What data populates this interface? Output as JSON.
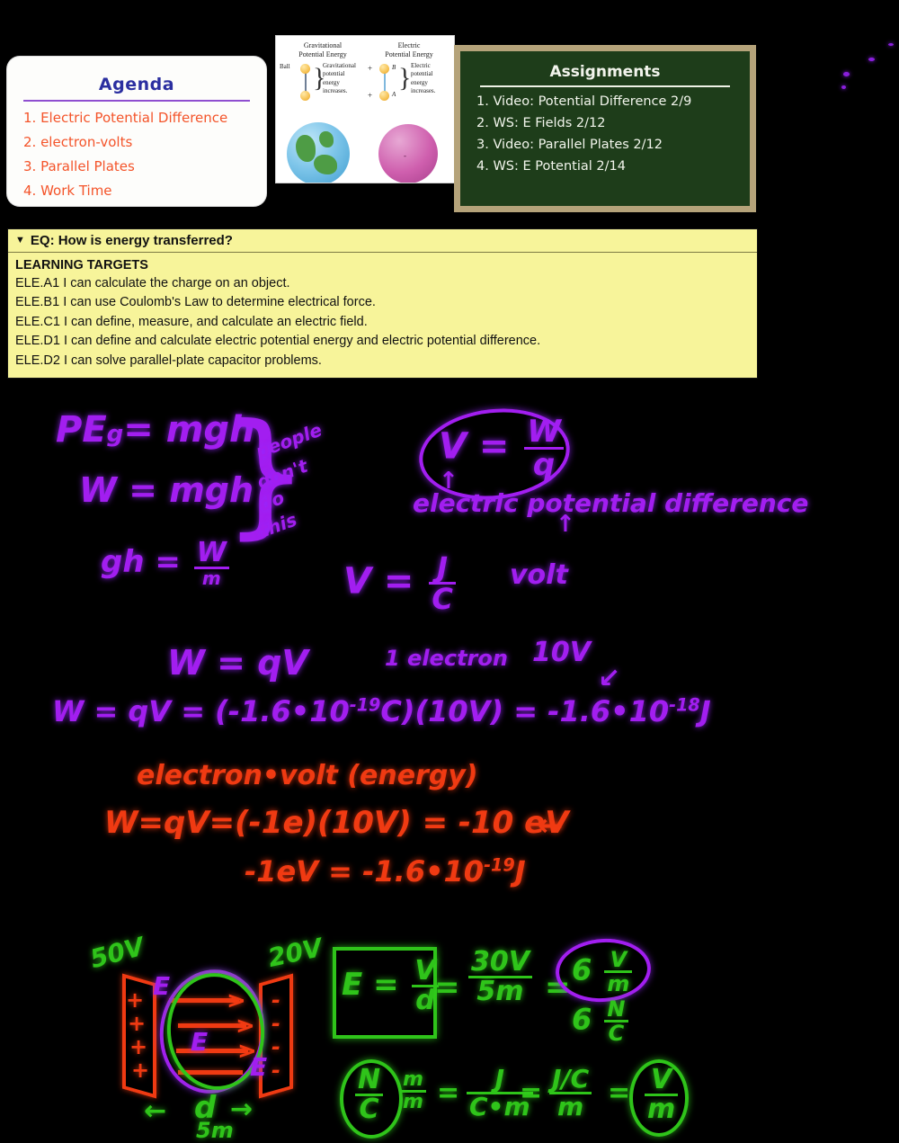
{
  "agenda": {
    "title": "Agenda",
    "items": [
      "1. Electric Potential Difference",
      "2. electron-volts",
      "3. Parallel Plates",
      "4. Work Time"
    ]
  },
  "assignments": {
    "title": "Assignments",
    "items": [
      "1. Video: Potential Difference 2/9",
      "2. WS: E Fields 2/12",
      "3. Video: Parallel Plates 2/12",
      "4. WS: E Potential 2/14"
    ]
  },
  "figure": {
    "left_title_line1": "Gravitational",
    "left_title_line2": "Potential Energy",
    "right_title_line1": "Electric",
    "right_title_line2": "Potential Energy",
    "ball_label": "Ball",
    "left_caption_line1": "Gravitational",
    "left_caption_line2": "potential",
    "left_caption_line3": "energy",
    "left_caption_line4": "increases.",
    "right_caption_line1": "Electric",
    "right_caption_line2": "potential",
    "right_caption_line3": "energy",
    "right_caption_line4": "increases.",
    "charge_top_sign": "+",
    "charge_bottom_sign": "+",
    "point_b": "B",
    "point_a": "A",
    "sphere_sign": "-"
  },
  "learning_targets": {
    "caret": "▼",
    "eq": "EQ: How is energy transferred?",
    "heading": "LEARNING TARGETS",
    "lines": [
      "ELE.A1 I can calculate the charge on an object.",
      "ELE.B1 I can use Coulomb's Law to determine electrical force.",
      "ELE.C1 I can define, measure, and calculate an electric field.",
      "ELE.D1 I can define and calculate electric potential energy and electric potential difference.",
      "ELE.D2 I can solve parallel-plate capacitor problems."
    ]
  },
  "notes": {
    "pe_eq": "PE",
    "pe_sub": "g",
    "pe_rest": "= mgh",
    "w_mgh": "W = mgh",
    "gh_left": "gh =",
    "gh_num": "W",
    "gh_den": "m",
    "brace_line1": "people",
    "brace_line2": "don't",
    "brace_line3": "do",
    "brace_line4": "this",
    "v_eq_left": "V =",
    "v_num": "W",
    "v_den": "q",
    "arrow_up_1": "↑",
    "epd_label": "electric potential difference",
    "arrow_up_2": "↑",
    "vjc_left": "V =",
    "vjc_num": "J",
    "vjc_den": "C",
    "volt_label": "volt",
    "w_qv": "W = qV",
    "one_electron": "1 electron",
    "ten_volts": "10V",
    "work_calc_a": "W = qV = (-1.6•10",
    "work_calc_exp1": "-19",
    "work_calc_b": "C)(10V) = -1.6•10",
    "work_calc_exp2": "-18",
    "work_calc_c": "J",
    "arrow_left_1": "↙",
    "ev_title": "electron•volt  (energy)",
    "ev_calc": "W=qV=(-1e)(10V) = -10 eV",
    "ev_arrow": "←",
    "ev_def_a": "-1eV = -1.6•10",
    "ev_def_exp": "-19",
    "ev_def_b": "J"
  },
  "plates": {
    "left_voltage": "50V",
    "right_voltage": "20V",
    "e_label_top": "E",
    "e_label_mid": "E",
    "e_label_bottom": "E",
    "plus_signs": [
      "+",
      "+",
      "+",
      "+"
    ],
    "minus_signs": [
      "-",
      "-",
      "-",
      "-"
    ],
    "d_arrow_left": "←",
    "d_label": "d",
    "d_arrow_right": "→",
    "d_value": "5m"
  },
  "field_calc": {
    "e_left": "E =",
    "e_num": "V",
    "e_den": "d",
    "eq1": "=",
    "f1_num": "30V",
    "f1_den": "5m",
    "eq2": "=",
    "result_value": "6",
    "result_num": "V",
    "result_den": "m",
    "alt_value": "6",
    "alt_num": "N",
    "alt_den": "C"
  },
  "unit_calc": {
    "t1_num": "N",
    "t1_den": "C",
    "t2_num": "m",
    "t2_den": "m",
    "eq1": "=",
    "t3_num": "J",
    "t3_den": "C•m",
    "eq2": "=",
    "t4_num": "J/C",
    "t4_den": "m",
    "eq3": "=",
    "t5_num": "V",
    "t5_den": "m"
  },
  "colors": {
    "purple_ink": "#a21ef0",
    "red_ink": "#f03a12",
    "green_ink": "#2fc41a",
    "agenda_title": "#2b2fa0",
    "agenda_item": "#f4542a",
    "chalkboard": "#1e3d1a",
    "chalk_frame": "#b5a37a",
    "note_yellow": "#f7f49a",
    "background": "#000000"
  }
}
